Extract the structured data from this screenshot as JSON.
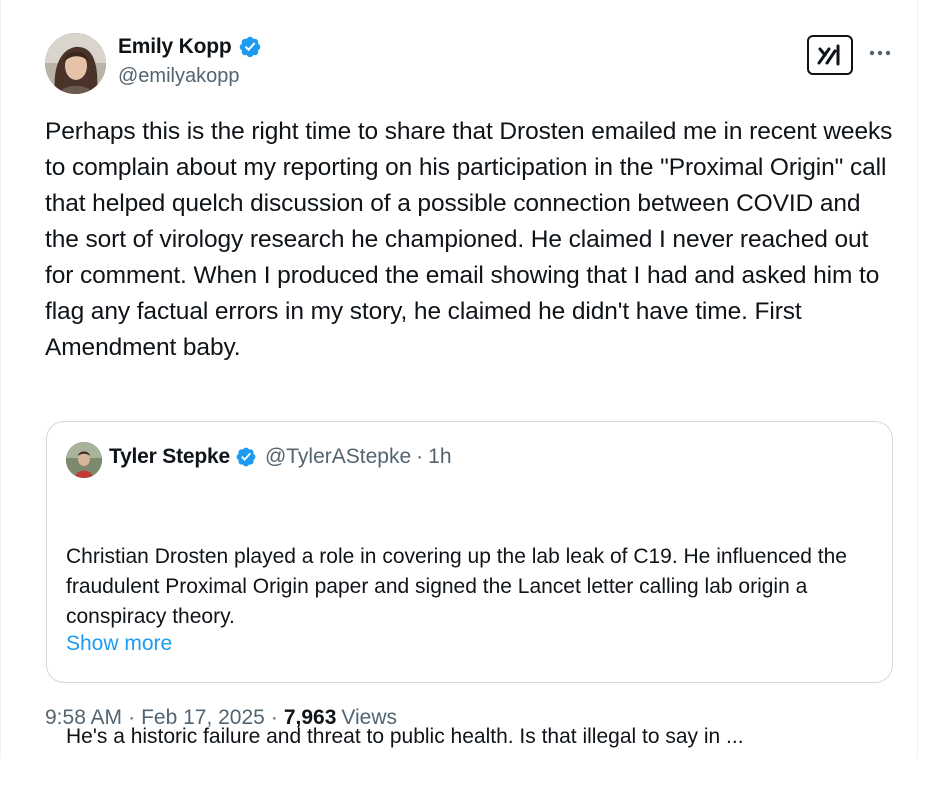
{
  "author": {
    "name": "Emily Kopp",
    "handle": "@emilyakopp",
    "verified": true
  },
  "icons": {
    "verified_badge": "verified-badge-icon",
    "grok": "grok-icon",
    "more": "more-options-icon"
  },
  "colors": {
    "verified": "#1d9bf0",
    "link": "#1d9bf0",
    "secondary_text": "#536471",
    "primary_text": "#0f1419",
    "border": "#cfd9de"
  },
  "tweet": {
    "text": "Perhaps this is the right time to share that Drosten emailed me in recent weeks to complain about my reporting on his participation in the \"Proximal Origin\" call that helped quelch discussion of a possible connection between COVID and the sort of virology research he championed. He claimed I never reached out for comment. When I produced the email showing that I had and asked him to flag any factual errors in my story, he claimed he didn't have time. First Amendment baby."
  },
  "quote": {
    "name": "Tyler Stepke",
    "handle": "@TylerAStepke",
    "separator": "·",
    "time": "1h",
    "paragraph1": "Christian Drosten played a role in covering up the lab leak of C19. He influenced the fraudulent Proximal Origin paper and signed the Lancet letter calling lab origin a conspiracy theory.",
    "paragraph2": "He's a historic failure and threat to public health. Is that illegal to say in ...",
    "show_more": "Show more"
  },
  "meta": {
    "time": "9:58 AM",
    "separator": "·",
    "date": "Feb 17, 2025",
    "views_count": "7,963",
    "views_label": "Views"
  }
}
